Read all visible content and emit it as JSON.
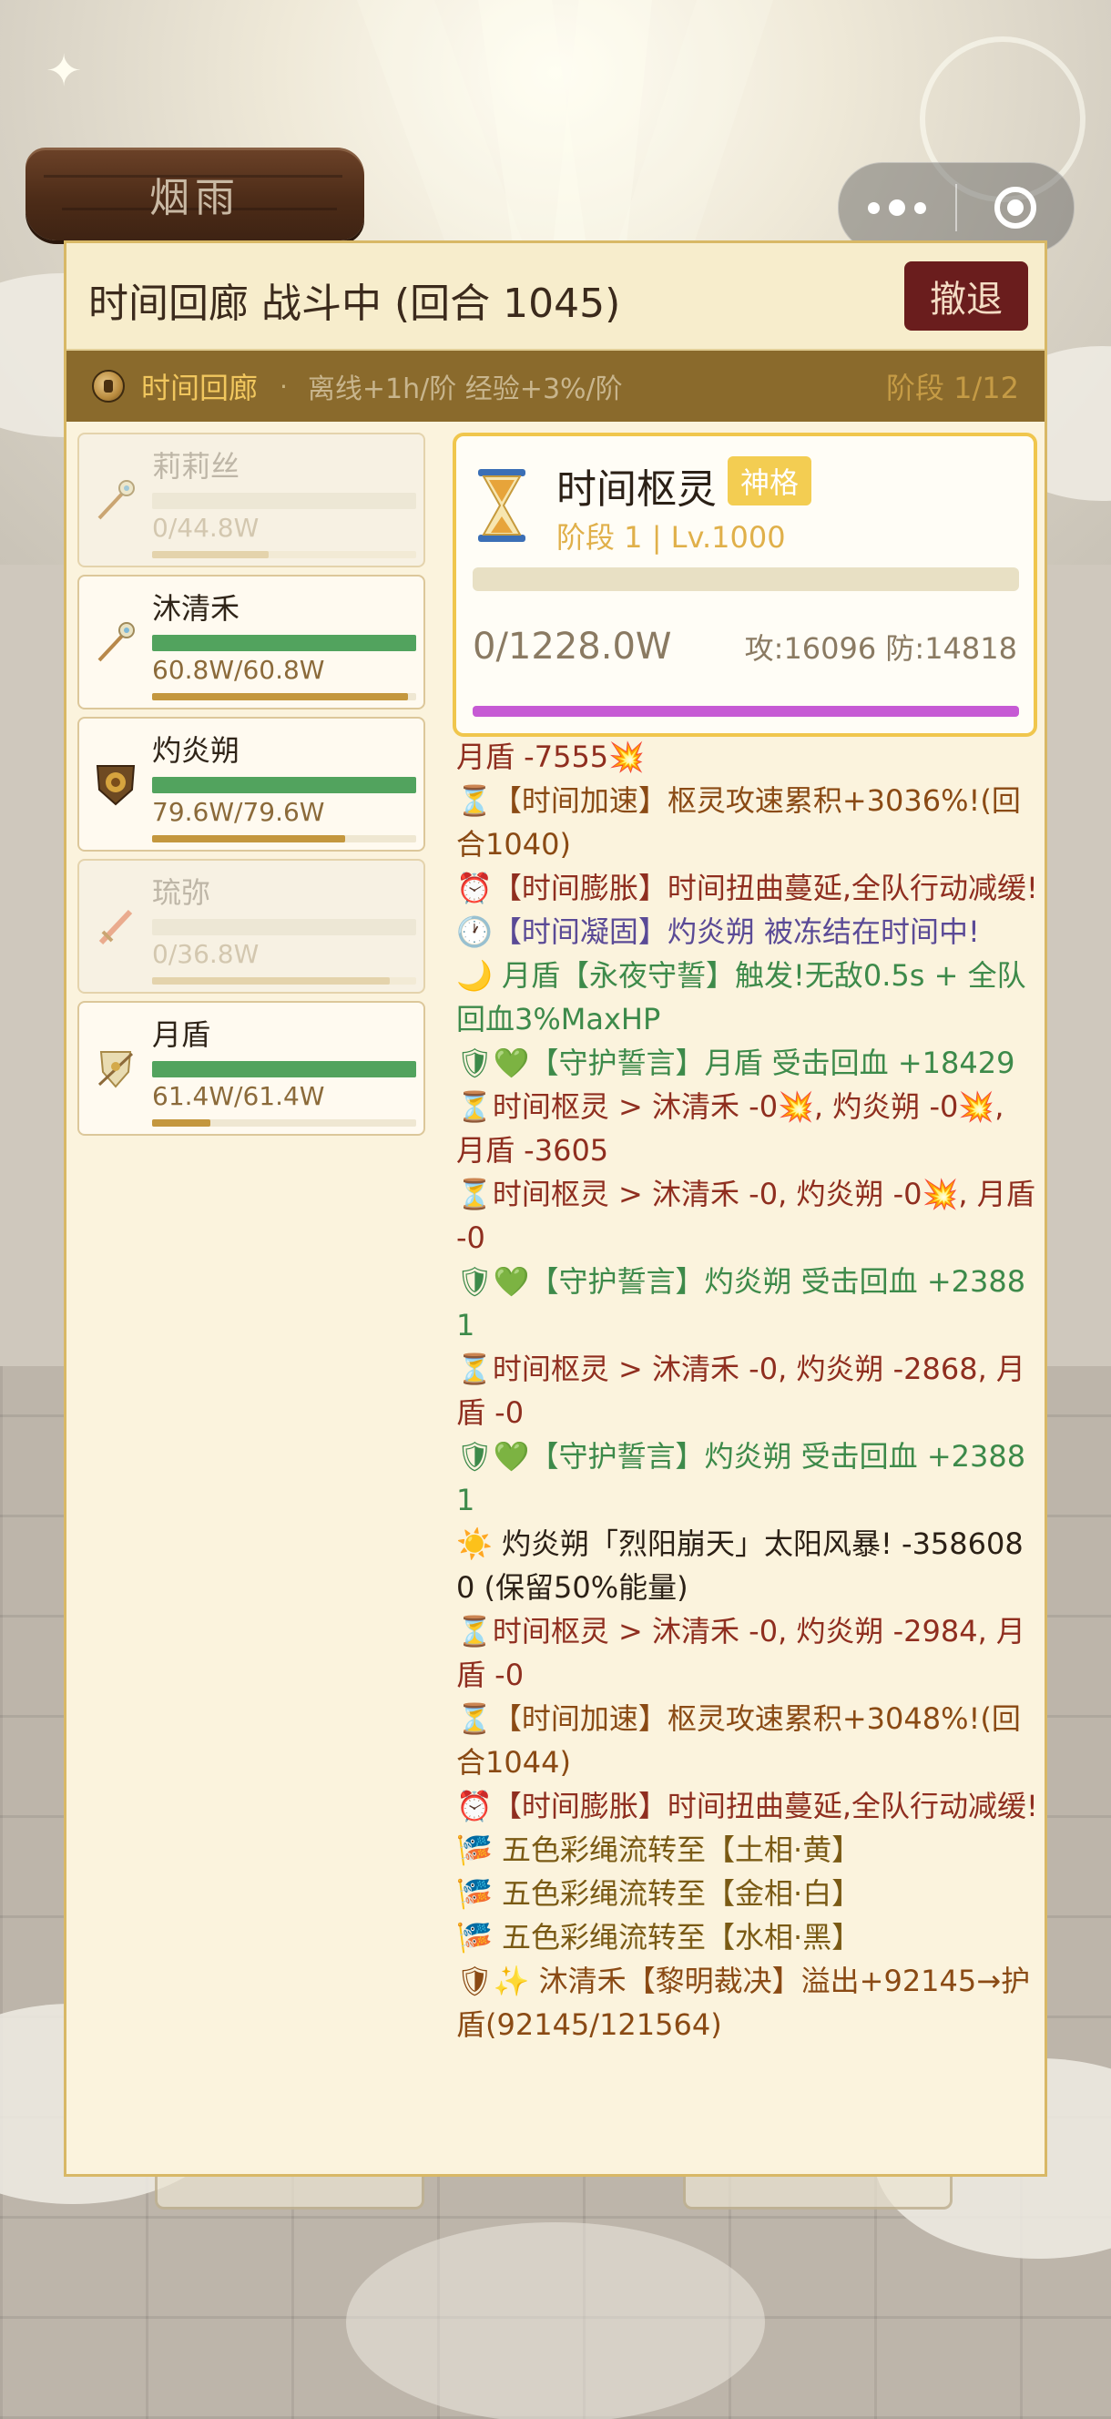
{
  "sign": {
    "text": "烟雨"
  },
  "panel": {
    "title": "时间回廊 战斗中 (回合 1045)",
    "retreat_label": "撤退",
    "stage": {
      "name": "时间回廊",
      "dot": "·",
      "info": "离线+1h/阶 经验+3%/阶",
      "level": "阶段 1/12"
    }
  },
  "heroes": [
    {
      "name": "莉莉丝",
      "hp": "0/44.8W",
      "hp_fraction": 0.0,
      "xp_fraction": 0.44,
      "dead": true,
      "icon": "staff-icon"
    },
    {
      "name": "沐清禾",
      "hp": "60.8W/60.8W",
      "hp_fraction": 1.0,
      "xp_fraction": 0.97,
      "dead": false,
      "icon": "staff-icon"
    },
    {
      "name": "灼炎朔",
      "hp": "79.6W/79.6W",
      "hp_fraction": 1.0,
      "xp_fraction": 0.73,
      "dead": false,
      "icon": "lion-shield-icon"
    },
    {
      "name": "琉弥",
      "hp": "0/36.8W",
      "hp_fraction": 0.0,
      "xp_fraction": 0.9,
      "dead": true,
      "icon": "sword-icon"
    },
    {
      "name": "月盾",
      "hp": "61.4W/61.4W",
      "hp_fraction": 1.0,
      "xp_fraction": 0.22,
      "dead": false,
      "icon": "shield-icon"
    }
  ],
  "boss": {
    "name": "时间枢灵",
    "badge": "神格",
    "stage": "阶段 1 | Lv.1000",
    "hp": "0/1228.0W",
    "stats": "攻:16096 防:14818",
    "icon": "hourglass-icon"
  },
  "log": [
    {
      "text": "月盾 -7555💥",
      "tone": "red"
    },
    {
      "text": "⏳【时间加速】枢灵攻速累积+3036%!(回合1040)",
      "tone": "brown"
    },
    {
      "text": "⏰【时间膨胀】时间扭曲蔓延,全队行动减缓!",
      "tone": "red"
    },
    {
      "text": "🕐【时间凝固】灼炎朔 被冻结在时间中!",
      "tone": "purple"
    },
    {
      "text": "🌙 月盾【永夜守誓】触发!无敌0.5s + 全队回血3%MaxHP",
      "tone": "green"
    },
    {
      "text": "🛡💚【守护誓言】月盾 受击回血 +18429",
      "tone": "green"
    },
    {
      "text": "⏳时间枢灵 > 沐清禾 -0💥, 灼炎朔 -0💥, 月盾 -3605",
      "tone": "red"
    },
    {
      "text": "⏳时间枢灵 > 沐清禾 -0, 灼炎朔 -0💥, 月盾 -0",
      "tone": "red"
    },
    {
      "text": "🛡💚【守护誓言】灼炎朔 受击回血 +23881",
      "tone": "green"
    },
    {
      "text": "⏳时间枢灵 > 沐清禾 -0, 灼炎朔 -2868, 月盾 -0",
      "tone": "red"
    },
    {
      "text": "🛡💚【守护誓言】灼炎朔 受击回血 +23881",
      "tone": "green"
    },
    {
      "text": "☀️ 灼炎朔「烈阳崩天」太阳风暴! -3586080 (保留50%能量)",
      "tone": "dark"
    },
    {
      "text": "⏳时间枢灵 > 沐清禾 -0, 灼炎朔 -2984, 月盾 -0",
      "tone": "red"
    },
    {
      "text": "⏳【时间加速】枢灵攻速累积+3048%!(回合1044)",
      "tone": "brown"
    },
    {
      "text": "⏰【时间膨胀】时间扭曲蔓延,全队行动减缓!",
      "tone": "red"
    },
    {
      "text": "🎏 五色彩绳流转至【土相·黄】",
      "tone": "gold"
    },
    {
      "text": "🎏 五色彩绳流转至【金相·白】",
      "tone": "gold"
    },
    {
      "text": "🎏 五色彩绳流转至【水相·黑】",
      "tone": "gold"
    },
    {
      "text": "🛡✨ 沐清禾【黎明裁决】溢出+92145→护盾(92145/121564)",
      "tone": "brown"
    }
  ],
  "colors": {
    "hp_green": "#52a35e",
    "xp_gold": "#c4973e",
    "boss_badge": "#f3cd52",
    "boss_bar": "#c65ad4",
    "retreat": "#6a1d1d"
  }
}
